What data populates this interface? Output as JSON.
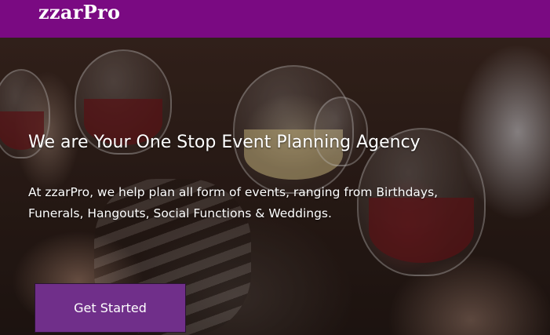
{
  "navbar": {
    "brand": "zzarPro",
    "background_color": "#7a0a82"
  },
  "hero": {
    "headline": "We are Your One Stop Event Planning Agency",
    "description": "At zzarPro, we help plan all form of events, ranging from Birthdays, Funerals, Hangouts, Social Functions & Weddings.",
    "cta_label": "Get Started",
    "cta_color": "#702f8a",
    "background_image": "people-toasting-wine-glasses"
  }
}
